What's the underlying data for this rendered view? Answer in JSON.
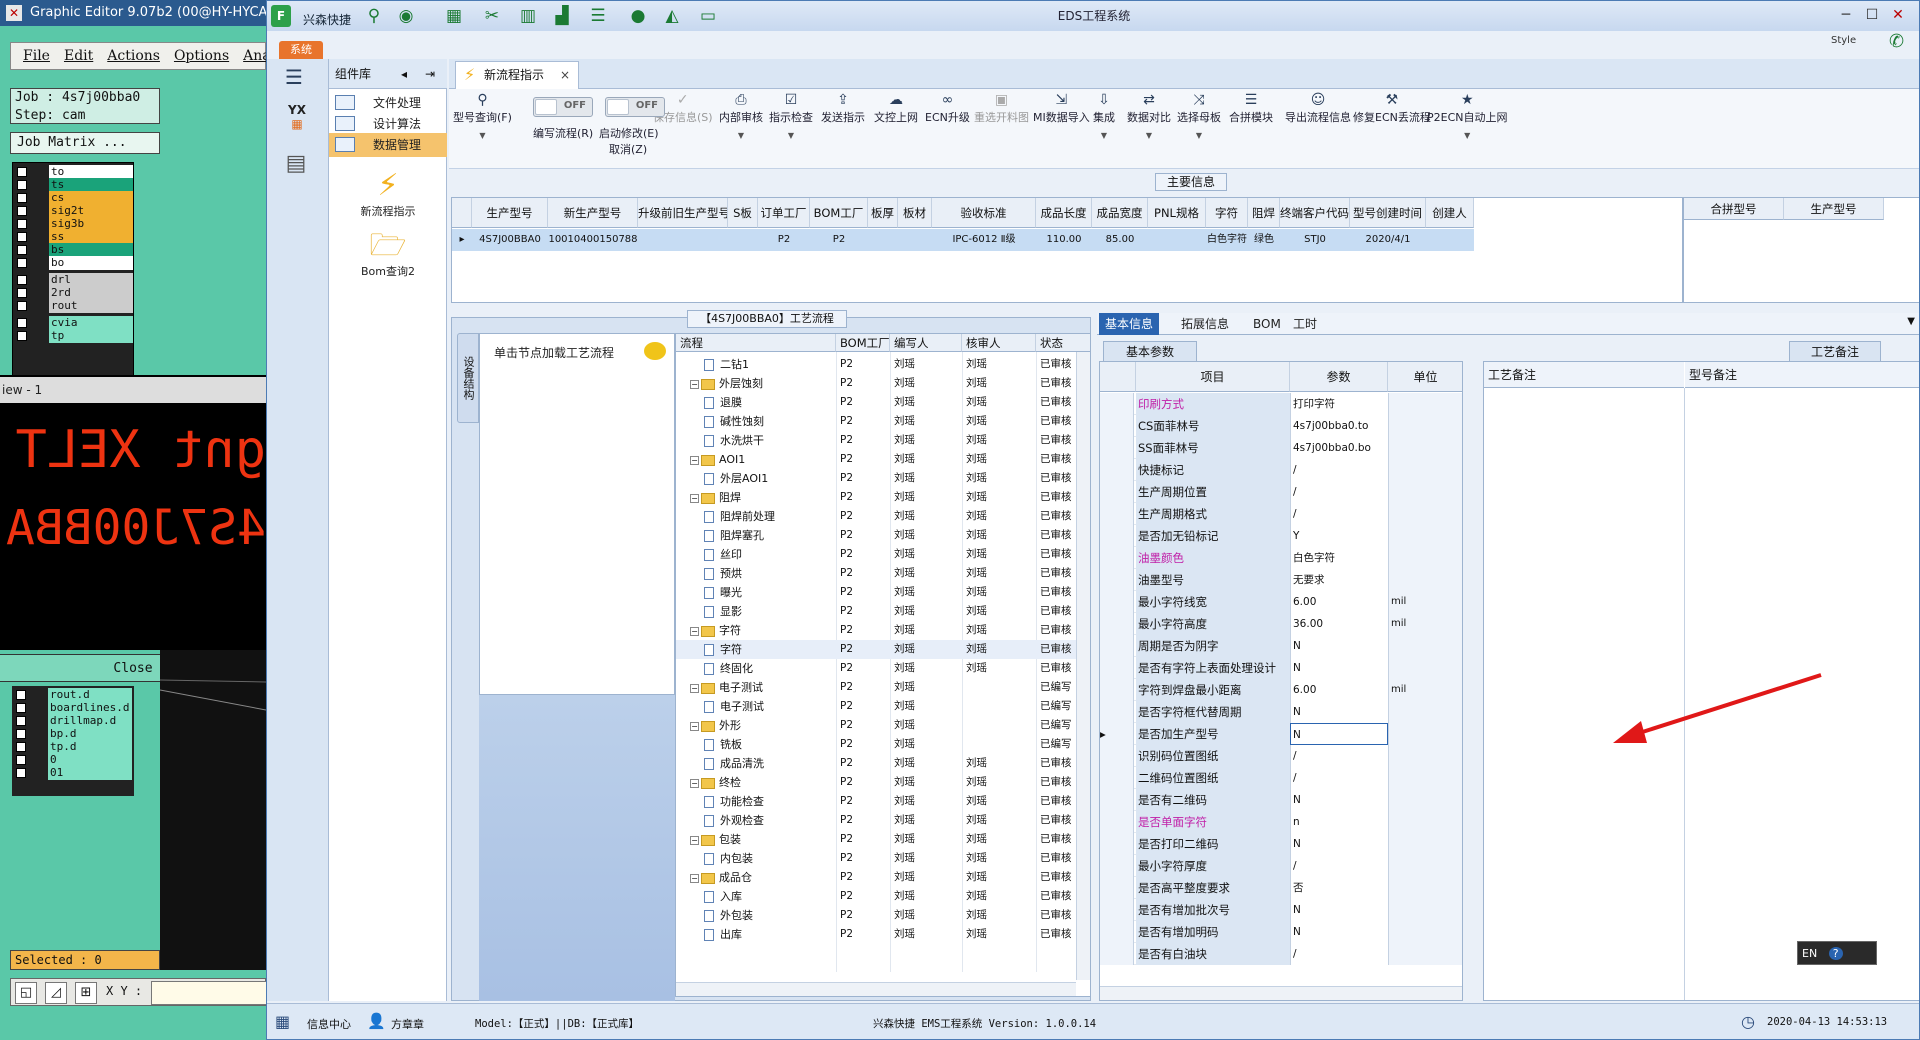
{
  "graphic_editor": {
    "title": "Graphic Editor 9.07b2 (00@HY-HYCAM-",
    "menu": [
      "File",
      "Edit",
      "Actions",
      "Options",
      "Ana"
    ],
    "job_label": "Job : 4s7j00bba0",
    "step_label": "Step: cam",
    "job_matrix_label": "Job Matrix ...",
    "layers_top": [
      {
        "name": "to",
        "color": "#ffffff"
      },
      {
        "name": "ts",
        "color": "#1aa37a"
      },
      {
        "name": "cs",
        "color": "#f0b030"
      },
      {
        "name": "sig2t",
        "color": "#f0b030"
      },
      {
        "name": "sig3b",
        "color": "#f0b030"
      },
      {
        "name": "ss",
        "color": "#f0b030"
      },
      {
        "name": "bs",
        "color": "#1aa37a"
      },
      {
        "name": "bo",
        "color": "#ffffff"
      },
      {
        "name": "drl",
        "color": "#cccccc"
      },
      {
        "name": "2rd",
        "color": "#cccccc"
      },
      {
        "name": "rout",
        "color": "#cccccc"
      },
      {
        "name": "cvia",
        "color": "#7fe0c4"
      },
      {
        "name": "tp",
        "color": "#7fe0c4"
      }
    ],
    "view_label": "iew - 1",
    "mirror_text_1": "gnt XELT",
    "mirror_text_2": "4S7J00BBA",
    "close_label": "Close",
    "layers_bottom": [
      "rout.d",
      "boardlines.d",
      "drillmap.d",
      "bp.d",
      "tp.d",
      "0",
      "01"
    ],
    "selected_label": "Selected : 0",
    "xy_label": "X Y :"
  },
  "eds": {
    "window_title": "EDS工程系统",
    "app_name": "兴森快捷",
    "style_label": "Style",
    "system_tab": "系统",
    "component_lib": "组件库",
    "nav_items": [
      {
        "label": "文件处理",
        "selected": false
      },
      {
        "label": "设计算法",
        "selected": false
      },
      {
        "label": "数据管理",
        "selected": true
      }
    ],
    "nav_big": [
      {
        "label": "新流程指示",
        "icon": "lightning-icon"
      },
      {
        "label": "Bom查询2",
        "icon": "folder-icon"
      }
    ],
    "tab_label": "新流程指示",
    "toolbar": {
      "items": [
        {
          "label": "型号查询(F)",
          "icon": "search-icon",
          "disabled": false,
          "dropdown": true
        },
        {
          "label": "保存信息(S)",
          "icon": "check-icon",
          "disabled": true,
          "dropdown": false
        },
        {
          "label": "内部审核",
          "icon": "print-icon",
          "disabled": false,
          "dropdown": true
        },
        {
          "label": "指示检查",
          "icon": "clipboard-check-icon",
          "disabled": false,
          "dropdown": true
        },
        {
          "label": "发送指示",
          "icon": "upload-icon",
          "disabled": false,
          "dropdown": false
        },
        {
          "label": "文控上网",
          "icon": "cloud-upload-icon",
          "disabled": false,
          "dropdown": false
        },
        {
          "label": "ECN升级",
          "icon": "binoculars-icon",
          "disabled": false,
          "dropdown": false
        },
        {
          "label": "重选开料图",
          "icon": "image-icon",
          "disabled": true,
          "dropdown": false
        },
        {
          "label": "MI数据导入",
          "icon": "import-icon",
          "disabled": false,
          "dropdown": false
        },
        {
          "label": "集成",
          "icon": "download-icon",
          "disabled": false,
          "dropdown": true
        },
        {
          "label": "数据对比",
          "icon": "compare-icon",
          "disabled": false,
          "dropdown": true
        },
        {
          "label": "选择母板",
          "icon": "shuffle-icon",
          "disabled": false,
          "dropdown": true
        },
        {
          "label": "合拼模块",
          "icon": "list-icon",
          "disabled": false,
          "dropdown": false
        },
        {
          "label": "导出流程信息",
          "icon": "smile-icon",
          "disabled": false,
          "dropdown": false
        },
        {
          "label": "修复ECN丢流程",
          "icon": "wrench-icon",
          "disabled": false,
          "dropdown": false
        },
        {
          "label": "P2ECN自动上网",
          "icon": "star-icon",
          "disabled": false,
          "dropdown": true
        }
      ],
      "toggle_off": "OFF",
      "toggle1_label": "编写流程(R)",
      "toggle2_label": "启动修改(E)",
      "toggle2_sub": "取消(Z)"
    },
    "main_info_title": "主要信息",
    "main_grid": {
      "columns": [
        "生产型号",
        "新生产型号",
        "升级前旧生产型号",
        "S板",
        "订单工厂",
        "BOM工厂",
        "板厚",
        "板材",
        "验收标准",
        "成品长度",
        "成品宽度",
        "PNL规格",
        "字符",
        "阻焊",
        "终端客户代码",
        "型号创建时间",
        "创建人"
      ],
      "row": [
        "4S7J00BBA0",
        "10010400150788",
        "",
        "",
        "P2",
        "P2",
        "",
        "",
        "IPC-6012 Ⅱ级",
        "110.00",
        "85.00",
        "",
        "白色字符",
        "绿色",
        "STJ0",
        "2020/4/1",
        ""
      ],
      "right_columns": [
        "合拼型号",
        "生产型号"
      ]
    },
    "process_title": "【4S7J00BBA0】工艺流程",
    "side_tab": "设备结构",
    "hint": "单击节点加载工艺流程",
    "tree_columns": [
      "流程",
      "BOM工厂",
      "编写人",
      "核审人",
      "状态"
    ],
    "tree_rows": [
      {
        "name": "二钻1",
        "level": 2,
        "type": "doc",
        "factory": "P2",
        "writer": "刘瑶",
        "checker": "刘瑶",
        "status": "已审核"
      },
      {
        "name": "外层蚀刻",
        "level": 1,
        "type": "folder",
        "factory": "P2",
        "writer": "刘瑶",
        "checker": "刘瑶",
        "status": "已审核"
      },
      {
        "name": "退膜",
        "level": 2,
        "type": "doc",
        "factory": "P2",
        "writer": "刘瑶",
        "checker": "刘瑶",
        "status": "已审核"
      },
      {
        "name": "碱性蚀刻",
        "level": 2,
        "type": "doc",
        "factory": "P2",
        "writer": "刘瑶",
        "checker": "刘瑶",
        "status": "已审核"
      },
      {
        "name": "水洗烘干",
        "level": 2,
        "type": "doc",
        "factory": "P2",
        "writer": "刘瑶",
        "checker": "刘瑶",
        "status": "已审核"
      },
      {
        "name": "AOI1",
        "level": 1,
        "type": "folder",
        "factory": "P2",
        "writer": "刘瑶",
        "checker": "刘瑶",
        "status": "已审核"
      },
      {
        "name": "外层AOI1",
        "level": 2,
        "type": "doc",
        "factory": "P2",
        "writer": "刘瑶",
        "checker": "刘瑶",
        "status": "已审核"
      },
      {
        "name": "阻焊",
        "level": 1,
        "type": "folder",
        "factory": "P2",
        "writer": "刘瑶",
        "checker": "刘瑶",
        "status": "已审核"
      },
      {
        "name": "阻焊前处理",
        "level": 2,
        "type": "doc",
        "factory": "P2",
        "writer": "刘瑶",
        "checker": "刘瑶",
        "status": "已审核"
      },
      {
        "name": "阻焊塞孔",
        "level": 2,
        "type": "doc",
        "factory": "P2",
        "writer": "刘瑶",
        "checker": "刘瑶",
        "status": "已审核"
      },
      {
        "name": "丝印",
        "level": 2,
        "type": "doc",
        "factory": "P2",
        "writer": "刘瑶",
        "checker": "刘瑶",
        "status": "已审核"
      },
      {
        "name": "预烘",
        "level": 2,
        "type": "doc",
        "factory": "P2",
        "writer": "刘瑶",
        "checker": "刘瑶",
        "status": "已审核"
      },
      {
        "name": "曝光",
        "level": 2,
        "type": "doc",
        "factory": "P2",
        "writer": "刘瑶",
        "checker": "刘瑶",
        "status": "已审核"
      },
      {
        "name": "显影",
        "level": 2,
        "type": "doc",
        "factory": "P2",
        "writer": "刘瑶",
        "checker": "刘瑶",
        "status": "已审核"
      },
      {
        "name": "字符",
        "level": 1,
        "type": "folder",
        "factory": "P2",
        "writer": "刘瑶",
        "checker": "刘瑶",
        "status": "已审核"
      },
      {
        "name": "字符",
        "level": 2,
        "type": "doc",
        "factory": "P2",
        "writer": "刘瑶",
        "checker": "刘瑶",
        "status": "已审核",
        "selected": true
      },
      {
        "name": "终固化",
        "level": 2,
        "type": "doc",
        "factory": "P2",
        "writer": "刘瑶",
        "checker": "刘瑶",
        "status": "已审核"
      },
      {
        "name": "电子测试",
        "level": 1,
        "type": "folder",
        "factory": "P2",
        "writer": "刘瑶",
        "checker": "",
        "status": "已编写"
      },
      {
        "name": "电子测试",
        "level": 2,
        "type": "doc",
        "factory": "P2",
        "writer": "刘瑶",
        "checker": "",
        "status": "已编写"
      },
      {
        "name": "外形",
        "level": 1,
        "type": "folder",
        "factory": "P2",
        "writer": "刘瑶",
        "checker": "",
        "status": "已编写"
      },
      {
        "name": "铣板",
        "level": 2,
        "type": "doc",
        "factory": "P2",
        "writer": "刘瑶",
        "checker": "",
        "status": "已编写"
      },
      {
        "name": "成品清洗",
        "level": 2,
        "type": "doc",
        "factory": "P2",
        "writer": "刘瑶",
        "checker": "刘瑶",
        "status": "已审核"
      },
      {
        "name": "终检",
        "level": 1,
        "type": "folder",
        "factory": "P2",
        "writer": "刘瑶",
        "checker": "刘瑶",
        "status": "已审核"
      },
      {
        "name": "功能检查",
        "level": 2,
        "type": "doc",
        "factory": "P2",
        "writer": "刘瑶",
        "checker": "刘瑶",
        "status": "已审核"
      },
      {
        "name": "外观检查",
        "level": 2,
        "type": "doc",
        "factory": "P2",
        "writer": "刘瑶",
        "checker": "刘瑶",
        "status": "已审核"
      },
      {
        "name": "包装",
        "level": 1,
        "type": "folder",
        "factory": "P2",
        "writer": "刘瑶",
        "checker": "刘瑶",
        "status": "已审核"
      },
      {
        "name": "内包装",
        "level": 2,
        "type": "doc",
        "factory": "P2",
        "writer": "刘瑶",
        "checker": "刘瑶",
        "status": "已审核"
      },
      {
        "name": "成品仓",
        "level": 1,
        "type": "folder",
        "factory": "P2",
        "writer": "刘瑶",
        "checker": "刘瑶",
        "status": "已审核"
      },
      {
        "name": "入库",
        "level": 2,
        "type": "doc",
        "factory": "P2",
        "writer": "刘瑶",
        "checker": "刘瑶",
        "status": "已审核"
      },
      {
        "name": "外包装",
        "level": 2,
        "type": "doc",
        "factory": "P2",
        "writer": "刘瑶",
        "checker": "刘瑶",
        "status": "已审核"
      },
      {
        "name": "出库",
        "level": 2,
        "type": "doc",
        "factory": "P2",
        "writer": "刘瑶",
        "checker": "刘瑶",
        "status": "已审核"
      }
    ],
    "detail_tabs": [
      {
        "label": "基本信息",
        "selected": true
      },
      {
        "label": "拓展信息",
        "selected": false
      },
      {
        "label": "BOM",
        "selected": false
      },
      {
        "label": "工时",
        "selected": false
      }
    ],
    "basic_param_tab": "基本参数",
    "param_columns": [
      "项目",
      "参数",
      "单位"
    ],
    "params": [
      {
        "name": "印刷方式",
        "value": "打印字符",
        "unit": "",
        "pink": true
      },
      {
        "name": "CS面菲林号",
        "value": "4s7j00bba0.to",
        "unit": "",
        "pink": false
      },
      {
        "name": "SS面菲林号",
        "value": "4s7j00bba0.bo",
        "unit": "",
        "pink": false
      },
      {
        "name": "快捷标记",
        "value": "/",
        "unit": "",
        "pink": false
      },
      {
        "name": "生产周期位置",
        "value": "/",
        "unit": "",
        "pink": false
      },
      {
        "name": "生产周期格式",
        "value": "/",
        "unit": "",
        "pink": false
      },
      {
        "name": "是否加无铅标记",
        "value": "Y",
        "unit": "",
        "pink": false
      },
      {
        "name": "油墨颜色",
        "value": "白色字符",
        "unit": "",
        "pink": true
      },
      {
        "name": "油墨型号",
        "value": "无要求",
        "unit": "",
        "pink": false
      },
      {
        "name": "最小字符线宽",
        "value": "6.00",
        "unit": "mil",
        "pink": false
      },
      {
        "name": "最小字符高度",
        "value": "36.00",
        "unit": "mil",
        "pink": false
      },
      {
        "name": "周期是否为阴字",
        "value": "N",
        "unit": "",
        "pink": false
      },
      {
        "name": "是否有字符上表面处理设计",
        "value": "N",
        "unit": "",
        "pink": false
      },
      {
        "name": "字符到焊盘最小距离",
        "value": "6.00",
        "unit": "mil",
        "pink": false
      },
      {
        "name": "是否字符框代替周期",
        "value": "N",
        "unit": "",
        "pink": false
      },
      {
        "name": "是否加生产型号",
        "value": "N",
        "unit": "",
        "pink": false,
        "current": true
      },
      {
        "name": "识别码位置图纸",
        "value": "/",
        "unit": "",
        "pink": false
      },
      {
        "name": "二维码位置图纸",
        "value": "/",
        "unit": "",
        "pink": false
      },
      {
        "name": "是否有二维码",
        "value": "N",
        "unit": "",
        "pink": false
      },
      {
        "name": "是否单面字符",
        "value": "n",
        "unit": "",
        "pink": true
      },
      {
        "name": "是否打印二维码",
        "value": "N",
        "unit": "",
        "pink": false
      },
      {
        "name": "最小字符厚度",
        "value": "/",
        "unit": "",
        "pink": false
      },
      {
        "name": "是否高平整度要求",
        "value": "否",
        "unit": "",
        "pink": false
      },
      {
        "name": "是否有增加批次号",
        "value": "N",
        "unit": "",
        "pink": false
      },
      {
        "name": "是否有增加明码",
        "value": "N",
        "unit": "",
        "pink": false
      },
      {
        "name": "是否有白油块",
        "value": "/",
        "unit": "",
        "pink": false
      }
    ],
    "remark_tab": "工艺备注",
    "remark_cols": [
      "工艺备注",
      "型号备注"
    ],
    "en_label": "EN",
    "status": {
      "info_center": "信息中心",
      "user": "方章章",
      "model": "Model:【正式】||DB:【正式库】",
      "version": "兴森快捷 EMS工程系统 Version: 1.0.0.14",
      "datetime": "2020-04-13 14:53:13"
    }
  }
}
